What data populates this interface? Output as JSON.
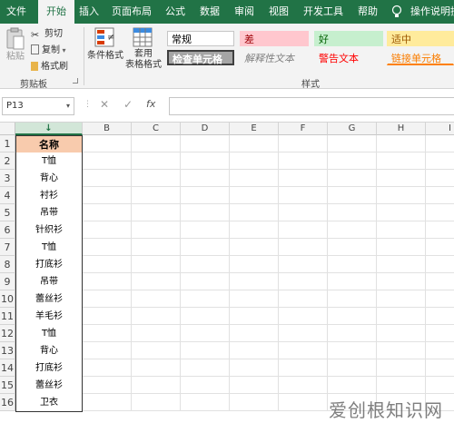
{
  "tabs": {
    "file": "文件",
    "home": "开始",
    "insert": "插入",
    "page_layout": "页面布局",
    "formulas": "公式",
    "data": "数据",
    "review": "审阅",
    "view": "视图",
    "developer": "开发工具",
    "help": "帮助",
    "tell_me": "操作说明搜"
  },
  "clipboard": {
    "paste": "粘贴",
    "cut": "剪切",
    "copy": "复制",
    "format_painter": "格式刷",
    "group_label": "剪贴板"
  },
  "styles": {
    "conditional_format": "条件格式",
    "format_as_table_line1": "套用",
    "format_as_table_line2": "表格格式",
    "normal": "常规",
    "bad": "差",
    "good": "好",
    "neutral": "适中",
    "check_cell": "检查单元格",
    "explanatory": "解释性文本",
    "warning": "警告文本",
    "linked_cell": "链接单元格",
    "group_label": "样式"
  },
  "formula_bar": {
    "name_box": "P13",
    "fx": "fx",
    "cancel": "✕",
    "enter": "✓",
    "value": ""
  },
  "columns": [
    "A",
    "B",
    "C",
    "D",
    "E",
    "F",
    "G",
    "H",
    "I"
  ],
  "column_a_header_marker": "↓",
  "rows": [
    "1",
    "2",
    "3",
    "4",
    "5",
    "6",
    "7",
    "8",
    "9",
    "10",
    "11",
    "12",
    "13",
    "14",
    "15",
    "16"
  ],
  "column_a": [
    "名称",
    "T恤",
    "背心",
    "衬衫",
    "吊带",
    "针织衫",
    "T恤",
    "打底衫",
    "吊带",
    "蕾丝衫",
    "羊毛衫",
    "T恤",
    "背心",
    "打底衫",
    "蕾丝衫",
    "卫衣"
  ],
  "watermark": "爱创根知识网",
  "colors": {
    "ribbon_green": "#217346",
    "header_fill": "#f8cbad"
  }
}
